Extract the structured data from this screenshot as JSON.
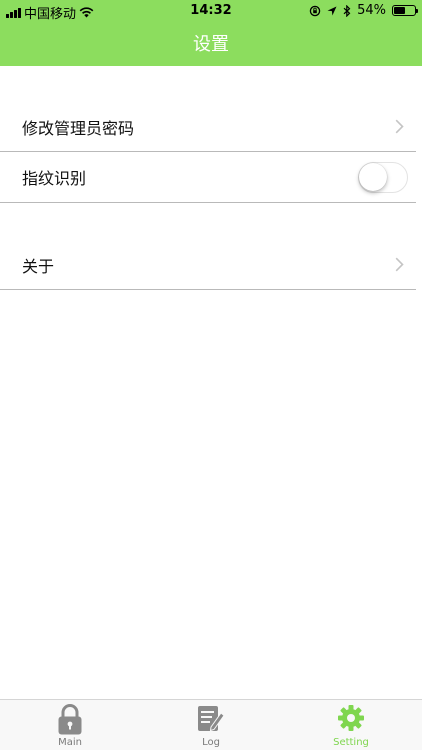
{
  "status_bar": {
    "carrier": "中国移动",
    "time": "14:32",
    "battery_percent": "54%",
    "battery_level": 0.54
  },
  "nav": {
    "title": "设置"
  },
  "settings": {
    "change_admin_password": "修改管理员密码",
    "fingerprint": "指纹识别",
    "fingerprint_enabled": false,
    "about": "关于"
  },
  "tabbar": {
    "items": [
      {
        "label": "Main",
        "icon": "lock-icon"
      },
      {
        "label": "Log",
        "icon": "log-icon"
      },
      {
        "label": "Setting",
        "icon": "gear-icon"
      }
    ],
    "active": "Setting"
  },
  "colors": {
    "accent_green": "#8cdd5e",
    "active_tab": "#7fd64f",
    "inactive_tab": "#7a7a7a"
  }
}
